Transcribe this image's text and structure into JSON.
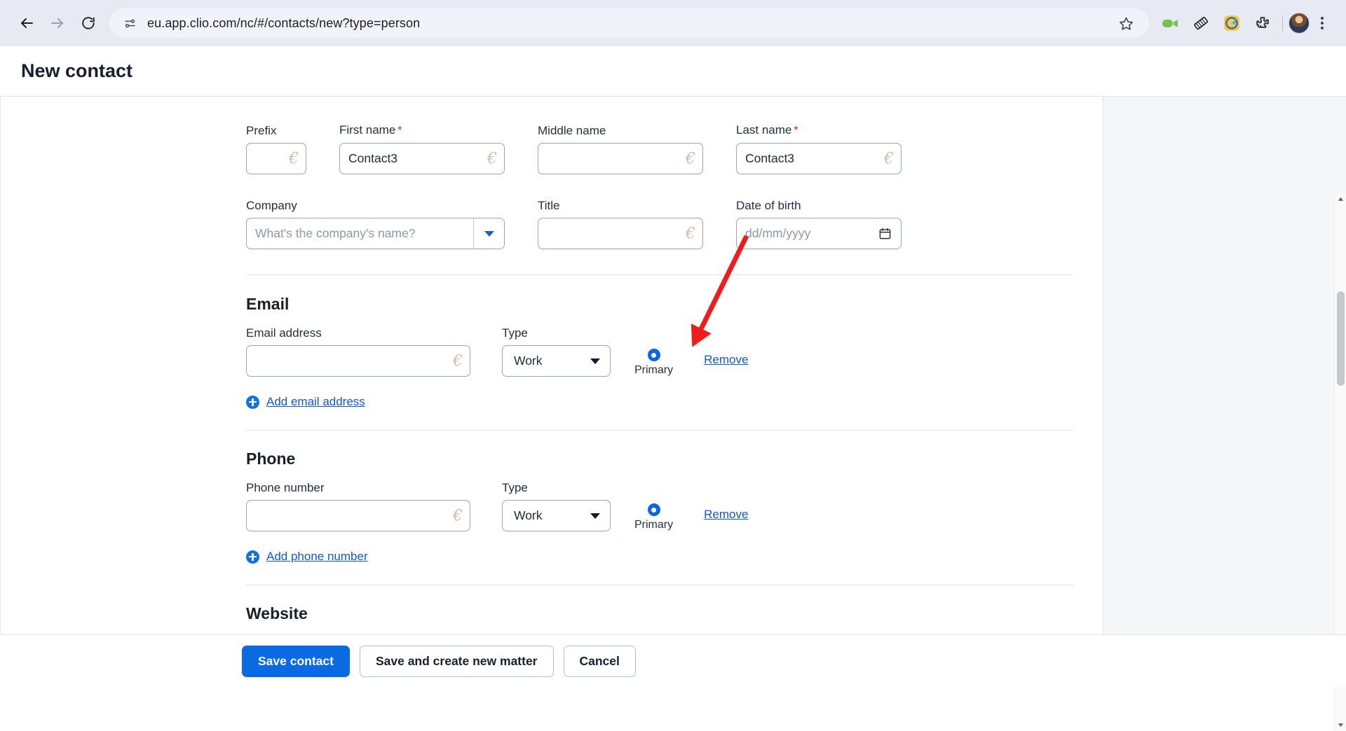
{
  "browser": {
    "url": "eu.app.clio.com/nc/#/contacts/new?type=person",
    "back_title": "Back",
    "forward_title": "Forward",
    "reload_title": "Reload",
    "site_info_title": "View site information",
    "bookmark_title": "Bookmark this tab",
    "extensions": [
      {
        "name": "video-recorder-extension-icon"
      },
      {
        "name": "notes-extension-icon"
      },
      {
        "name": "grammar-extension-icon"
      },
      {
        "name": "puzzle-extensions-icon"
      }
    ],
    "profile_title": "Profile",
    "menu_title": "Customize and control Google Chrome"
  },
  "page": {
    "title": "New contact"
  },
  "form": {
    "name_row": {
      "prefix": {
        "label": "Prefix",
        "value": ""
      },
      "first_name": {
        "label": "First name",
        "required": true,
        "value": "Contact3"
      },
      "middle_name": {
        "label": "Middle name",
        "value": ""
      },
      "last_name": {
        "label": "Last name",
        "required": true,
        "value": "Contact3"
      }
    },
    "detail_row": {
      "company": {
        "label": "Company",
        "value": "",
        "placeholder": "What's the company's name?"
      },
      "title": {
        "label": "Title",
        "value": ""
      },
      "dob": {
        "label": "Date of birth",
        "value": "",
        "placeholder": "dd/mm/yyyy"
      }
    },
    "email_section": {
      "heading": "Email",
      "address_label": "Email address",
      "address_value": "",
      "type_label": "Type",
      "type_value": "Work",
      "primary_label": "Primary",
      "primary_selected": true,
      "remove_label": "Remove",
      "add_label": "Add email address"
    },
    "phone_section": {
      "heading": "Phone",
      "number_label": "Phone number",
      "number_value": "",
      "type_label": "Type",
      "type_value": "Work",
      "primary_label": "Primary",
      "primary_selected": true,
      "remove_label": "Remove",
      "add_label": "Add phone number"
    },
    "website_section": {
      "heading": "Website"
    },
    "required_marker": "*"
  },
  "footer": {
    "save_label": "Save contact",
    "save_new_matter_label": "Save and create new matter",
    "cancel_label": "Cancel"
  },
  "colors": {
    "accent": "#0a6ae1",
    "link": "#1358c9",
    "required": "#d8202a",
    "annotation": "#ee1d1d"
  }
}
